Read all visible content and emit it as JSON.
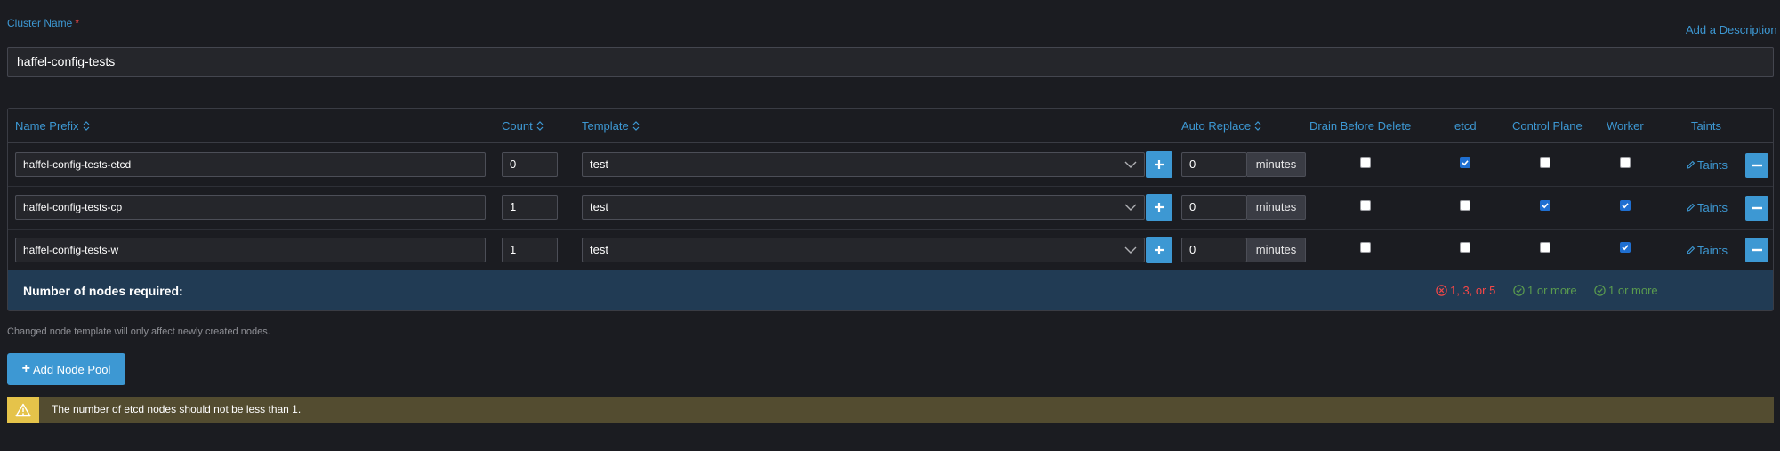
{
  "cluster": {
    "label": "Cluster Name",
    "required_mark": "*",
    "value": "haffel-config-tests",
    "add_description": "Add a Description"
  },
  "table": {
    "headers": {
      "name_prefix": "Name Prefix",
      "count": "Count",
      "template": "Template",
      "auto_replace": "Auto Replace",
      "drain_before_delete": "Drain Before Delete",
      "etcd": "etcd",
      "control_plane": "Control Plane",
      "worker": "Worker",
      "taints": "Taints"
    },
    "rows": [
      {
        "name_prefix": "haffel-config-tests-etcd",
        "count": "0",
        "template": "test",
        "auto_replace": "0",
        "minutes": "minutes",
        "drain": false,
        "etcd": true,
        "control_plane": false,
        "worker": false,
        "taints": "Taints"
      },
      {
        "name_prefix": "haffel-config-tests-cp",
        "count": "1",
        "template": "test",
        "auto_replace": "0",
        "minutes": "minutes",
        "drain": false,
        "etcd": false,
        "control_plane": true,
        "worker": true,
        "taints": "Taints"
      },
      {
        "name_prefix": "haffel-config-tests-w",
        "count": "1",
        "template": "test",
        "auto_replace": "0",
        "minutes": "minutes",
        "drain": false,
        "etcd": false,
        "control_plane": false,
        "worker": true,
        "taints": "Taints"
      }
    ],
    "summary": {
      "label": "Number of nodes required:",
      "etcd": "1, 3, or 5",
      "control_plane": "1 or more",
      "worker": "1 or more"
    }
  },
  "note": "Changed node template will only affect newly created nodes.",
  "add_pool_label": "Add Node Pool",
  "add_pool_plus": "+",
  "warning": "The number of etcd nodes should not be less than 1.",
  "colors": {
    "accent": "#3d98d3",
    "error": "#f64747",
    "success": "#5a9b4e",
    "warning_bg": "#534c30",
    "warning_icon": "#e5c34a",
    "summary_bg": "#213b54"
  },
  "icons": {
    "sort": "sort-icon",
    "chevron": "chevron-down-icon",
    "plus": "plus-icon",
    "minus": "minus-icon",
    "pencil": "pencil-icon",
    "error": "x-circle-icon",
    "success": "check-circle-icon",
    "warning": "warning-triangle-icon"
  }
}
